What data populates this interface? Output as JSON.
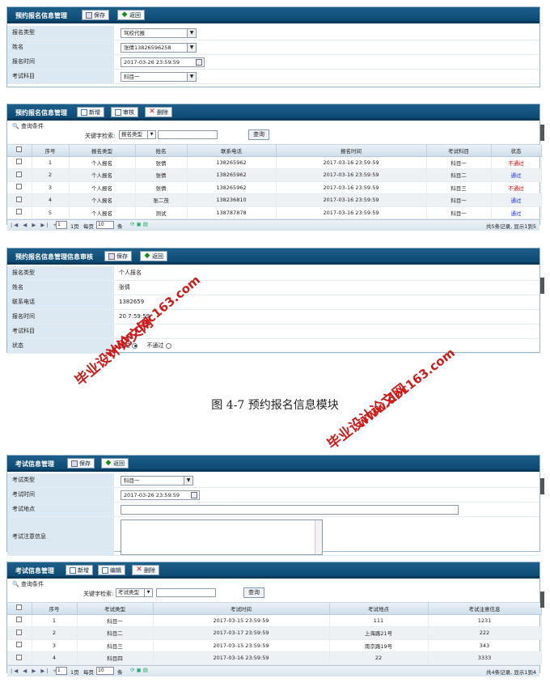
{
  "panel1": {
    "title": "预约报名信息管理",
    "save": "保存",
    "back": "返回",
    "fields": [
      {
        "label": "报名类型",
        "value": "驾校代报"
      },
      {
        "label": "姓名",
        "value": "张倩13826596258"
      },
      {
        "label": "报名时间",
        "value": "2017-03-26 23:59:59"
      },
      {
        "label": "考试科目",
        "value": "科目一"
      }
    ]
  },
  "panel2": {
    "title": "预约报名信息管理",
    "add": "新增",
    "audit": "审核",
    "del": "删除",
    "cond": "查询条件",
    "kw_label": "关键字检索:",
    "kw_select": "报名类型",
    "query": "查询",
    "headers": [
      "序号",
      "报名类型",
      "姓名",
      "联系电话",
      "报名时间",
      "考试科目",
      "状态"
    ],
    "rows": [
      [
        "1",
        "个人报名",
        "张倩",
        "138265962",
        "2017-03-16 23:59:59",
        "科目一",
        "不通过"
      ],
      [
        "2",
        "个人报名",
        "张倩",
        "138265962",
        "2017-03-16 23:59:59",
        "科目二",
        "通过"
      ],
      [
        "3",
        "个人报名",
        "张倩",
        "138265962",
        "2017-03-16 23:59:59",
        "科目三",
        "不通过"
      ],
      [
        "4",
        "个人报名",
        "张二茂",
        "138236810",
        "2017-03-16 23:59:59",
        "科目一",
        "通过"
      ],
      [
        "5",
        "个人报名",
        "测试",
        "138787878",
        "2017-03-16 23:59:59",
        "科目一",
        "通过"
      ]
    ],
    "pager_page": "1",
    "pager_total": "1页",
    "pager_per": "每页",
    "pager_size": "10",
    "pager_unit": "条",
    "pager_info": "共5条记录, 显示1到5"
  },
  "panel3": {
    "title": "预约报名信息管理信息审核",
    "save": "保存",
    "back": "返回",
    "fields": [
      {
        "label": "报名类型",
        "value": "个人报名"
      },
      {
        "label": "姓名",
        "value": "张倩"
      },
      {
        "label": "联系电话",
        "value": "1382659"
      },
      {
        "label": "报名时间",
        "value": "20 7:59:59"
      },
      {
        "label": "考试科目",
        "value": ""
      },
      {
        "label": "状态",
        "value": ""
      }
    ],
    "opt_pass": "通过",
    "opt_fail": "不通过"
  },
  "caption": "图 4-7 预约报名信息模块",
  "panel4": {
    "title": "考试信息管理",
    "save": "保存",
    "back": "返回",
    "fields": [
      {
        "label": "考试类型",
        "value": "科目一"
      },
      {
        "label": "考试时间",
        "value": "2017-03-26 23:59:59"
      },
      {
        "label": "考试地点",
        "value": ""
      },
      {
        "label": "考试注意信息",
        "value": ""
      }
    ]
  },
  "panel5": {
    "title": "考试信息管理",
    "add": "新增",
    "edit": "编辑",
    "del": "删除",
    "cond": "查询条件",
    "kw_label": "关键字检索:",
    "kw_select": "考试类型",
    "query": "查询",
    "headers": [
      "序号",
      "考试类型",
      "考试时间",
      "考试地点",
      "考试注意信息"
    ],
    "rows": [
      [
        "1",
        "科目一",
        "2017-03-15 23:59:59",
        "111",
        "1231"
      ],
      [
        "2",
        "科目二",
        "2017-03-17 23:59:59",
        "上海路21号",
        "222"
      ],
      [
        "3",
        "科目三",
        "2017-03-15 23:59:59",
        "南京路19号",
        "343"
      ],
      [
        "4",
        "科目四",
        "2017-03-16 23:59:59",
        "22",
        "3333"
      ]
    ],
    "pager_page": "1",
    "pager_total": "1页",
    "pager_per": "每页",
    "pager_size": "10",
    "pager_unit": "条",
    "pager_info": "共4条记录, 显示1到4"
  },
  "watermarks": {
    "a_cn": "毕业设计论文网",
    "a_url": "www.doc163.com",
    "b_cn": "毕业设计论文网",
    "b_url": "www.doc163.com"
  }
}
